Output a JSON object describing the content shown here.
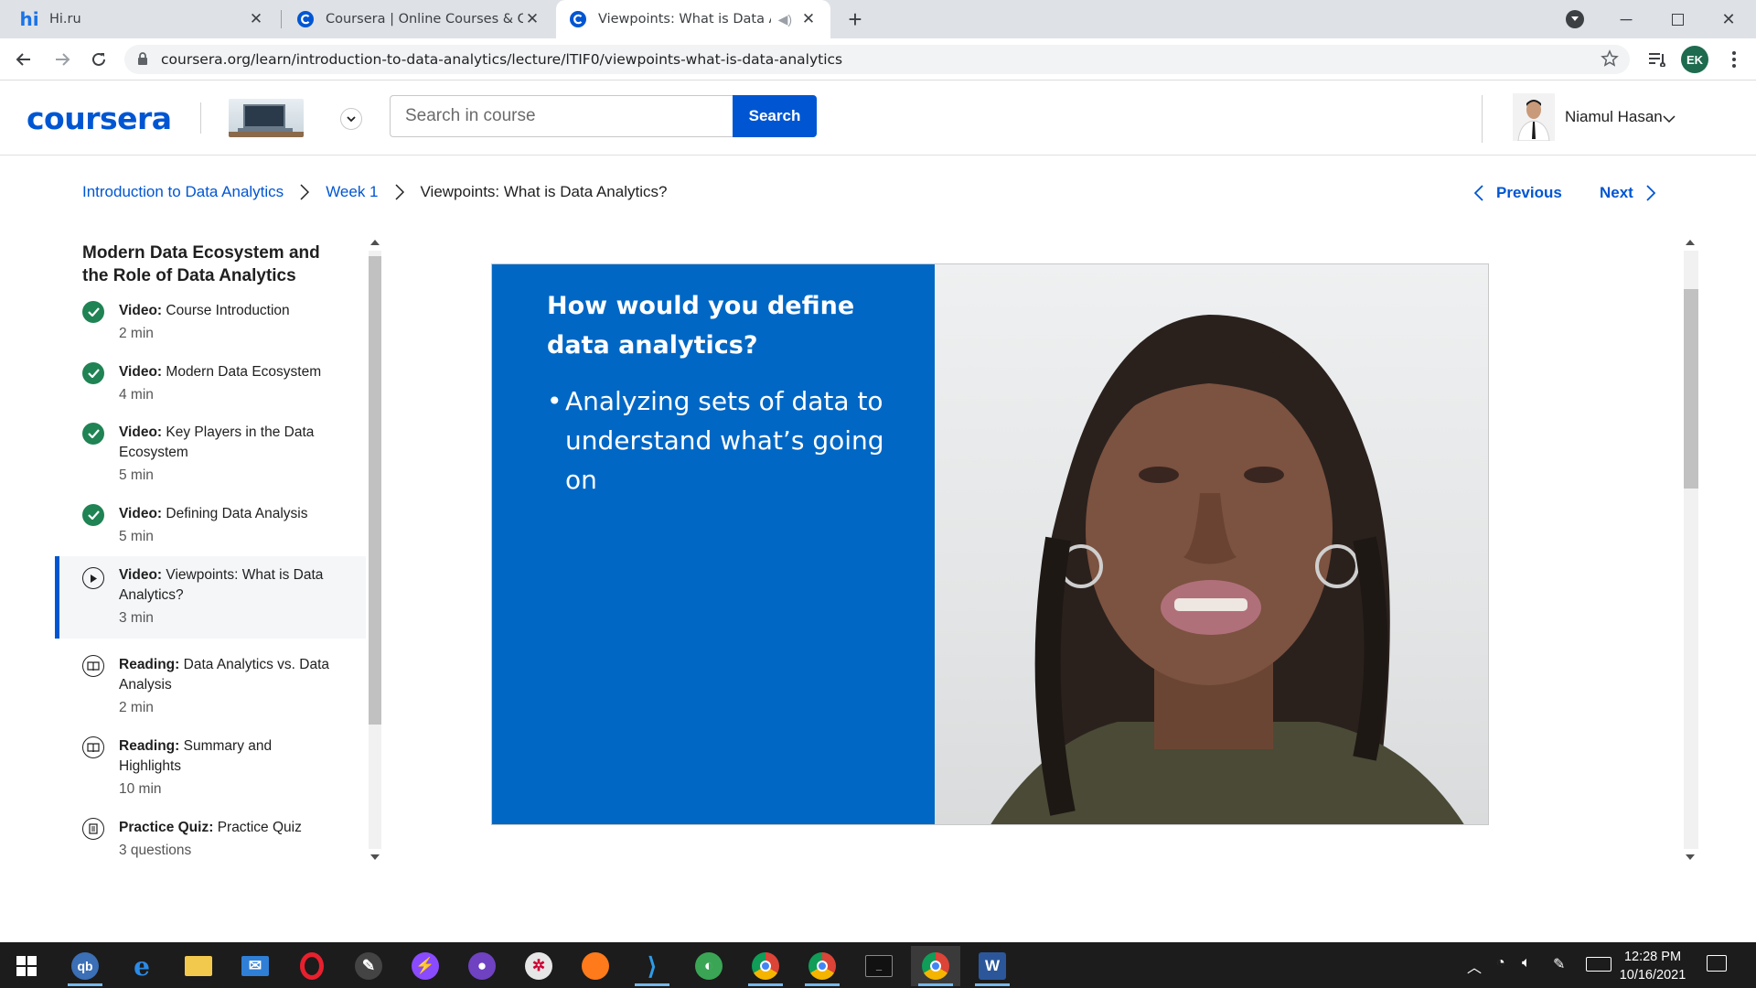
{
  "browser": {
    "tabs": [
      {
        "title": "Hi.ru",
        "favicon": "hi-ru-icon",
        "active": false
      },
      {
        "title": "Coursera | Online Courses & Crec",
        "favicon": "coursera-icon",
        "active": false
      },
      {
        "title": "Viewpoints: What is Data An",
        "favicon": "coursera-icon",
        "active": true
      }
    ],
    "url": "coursera.org/learn/introduction-to-data-analytics/lecture/lTIF0/viewpoints-what-is-data-analytics",
    "profile_initials": "EK"
  },
  "header": {
    "logo": "coursera",
    "search_placeholder": "Search in course",
    "search_button": "Search",
    "user_name": "Niamul Hasan"
  },
  "breadcrumb": {
    "course": "Introduction to Data Analytics",
    "week": "Week 1",
    "current": "Viewpoints: What is Data Analytics?"
  },
  "nav": {
    "previous": "Previous",
    "next": "Next"
  },
  "sidebar": {
    "module_title": "Modern Data Ecosystem and the Role of Data Analytics",
    "items": [
      {
        "type": "Video:",
        "title": "Course Introduction",
        "duration": "2 min",
        "status": "completed"
      },
      {
        "type": "Video:",
        "title": "Modern Data Ecosystem",
        "duration": "4 min",
        "status": "completed"
      },
      {
        "type": "Video:",
        "title": "Key Players in the Data Ecosystem",
        "duration": "5 min",
        "status": "completed"
      },
      {
        "type": "Video:",
        "title": "Defining Data Analysis",
        "duration": "5 min",
        "status": "completed"
      },
      {
        "type": "Video:",
        "title": "Viewpoints: What is Data Analytics?",
        "duration": "3 min",
        "status": "current"
      },
      {
        "type": "Reading:",
        "title": "Data Analytics vs. Data Analysis",
        "duration": "2 min",
        "status": "not-started"
      },
      {
        "type": "Reading:",
        "title": "Summary and Highlights",
        "duration": "10 min",
        "status": "not-started"
      },
      {
        "type": "Practice Quiz:",
        "title": "Practice Quiz",
        "duration": "3 questions",
        "status": "not-started"
      }
    ]
  },
  "video": {
    "slide_title": "How would you define data analytics?",
    "slide_bullet": "Analyzing sets of data to understand what’s going on"
  },
  "taskbar": {
    "time": "12:28 PM",
    "date": "10/16/2021"
  },
  "colors": {
    "brand": "#0056d2",
    "slide_blue": "#0067c5",
    "completed_green": "#1f8354"
  }
}
